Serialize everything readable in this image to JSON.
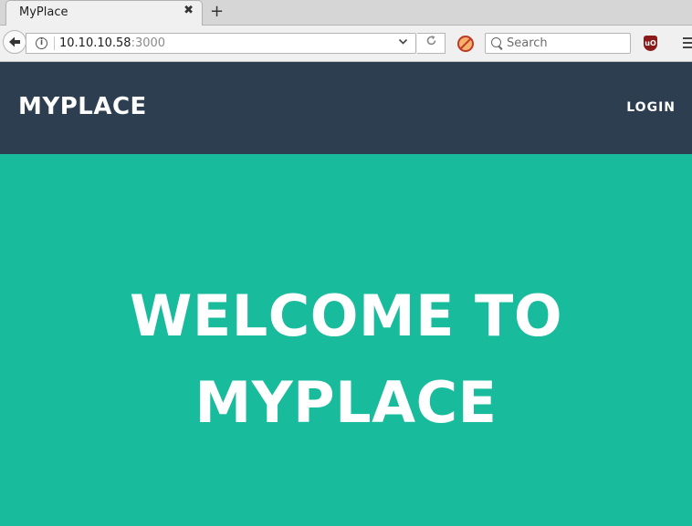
{
  "browser": {
    "tab_title": "MyPlace",
    "tab_close": "✖",
    "new_tab": "+",
    "url_host": "10.10.10.58",
    "url_port": ":3000",
    "search_placeholder": "Search",
    "ublock_label": "uO"
  },
  "site": {
    "brand": "MYPLACE",
    "nav_login": "LOGIN",
    "hero_line1": "WELCOME TO",
    "hero_line2": "MYPLACE",
    "nav_color": "#2c3e50",
    "hero_color": "#18bc9c"
  }
}
